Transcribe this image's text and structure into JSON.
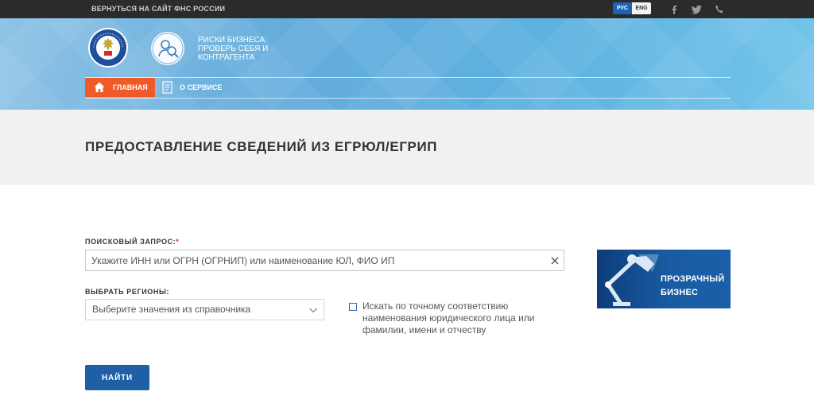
{
  "topbar": {
    "back_link": "ВЕРНУТЬСЯ НА САЙТ ФНС РОССИИ",
    "lang_ru": "РУС",
    "lang_en": "ENG",
    "icons": [
      "facebook-icon",
      "twitter-icon",
      "phone-icon"
    ]
  },
  "header": {
    "emblem_icon": "fns-emblem",
    "service_title": "РИСКИ БИЗНЕСА: ПРОВЕРЬ СЕБЯ И КОНТРАГЕНТА",
    "nav": {
      "home": "ГЛАВНАЯ",
      "about": "О СЕРВИСЕ"
    }
  },
  "page": {
    "title": "ПРЕДОСТАВЛЕНИЕ СВЕДЕНИЙ ИЗ ЕГРЮЛ/ЕГРИП"
  },
  "form": {
    "search_label": "ПОИСКОВЫЙ ЗАПРОС:",
    "required_mark": "*",
    "search_value": "",
    "search_placeholder": "Укажите ИНН или ОГРН (ОГРНИП) или наименование ЮЛ, ФИО ИП",
    "region_label": "ВЫБРАТЬ РЕГИОНЫ:",
    "region_placeholder": "Выберите значения из справочника",
    "exact_match_label": "Искать по точному соответствию наименования юридического лица или фамилии, имени и отчеству",
    "exact_match_checked": false,
    "submit_label": "НАЙТИ"
  },
  "banner": {
    "text": "ПРОЗРАЧНЫЙ БИЗНЕС"
  },
  "colors": {
    "accent_orange": "#ef5a28",
    "button_blue": "#1f5fa6",
    "topbar_dark": "#2b2b2b",
    "required_red": "#e0262b"
  }
}
